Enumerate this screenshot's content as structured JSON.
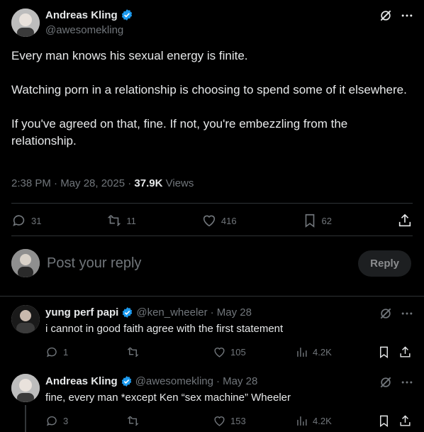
{
  "post": {
    "author_name": "Andreas Kling",
    "author_handle": "@awesomekling",
    "paragraphs": [
      "Every man knows his sexual energy is finite.",
      "Watching porn in a relationship is choosing to spend some of it elsewhere.",
      "If you've agreed on that, fine. If not, you're embezzling from the relationship."
    ],
    "timestamp": "2:38 PM · May 28, 2025 ·",
    "views_count": "37.9K",
    "views_label": "Views",
    "replies": "31",
    "reposts": "11",
    "likes": "416",
    "bookmarks": "62"
  },
  "composer": {
    "placeholder": "Post your reply",
    "button": "Reply"
  },
  "replies": [
    {
      "name": "yung perf papi",
      "handle": "@ken_wheeler",
      "date": "· May 28",
      "text": "i cannot in good faith agree with the first statement",
      "replies": "1",
      "reposts": "",
      "likes": "105",
      "views": "4.2K"
    },
    {
      "name": "Andreas Kling",
      "handle": "@awesomekling",
      "date": "· May 28",
      "text": "fine, every man *except Ken “sex machine” Wheeler",
      "replies": "3",
      "reposts": "",
      "likes": "153",
      "views": "4.2K"
    }
  ],
  "colors": {
    "background": "#000000",
    "text": "#e7e9ea",
    "muted": "#71767b",
    "verified": "#1d9bf0",
    "divider": "#2f3336"
  }
}
